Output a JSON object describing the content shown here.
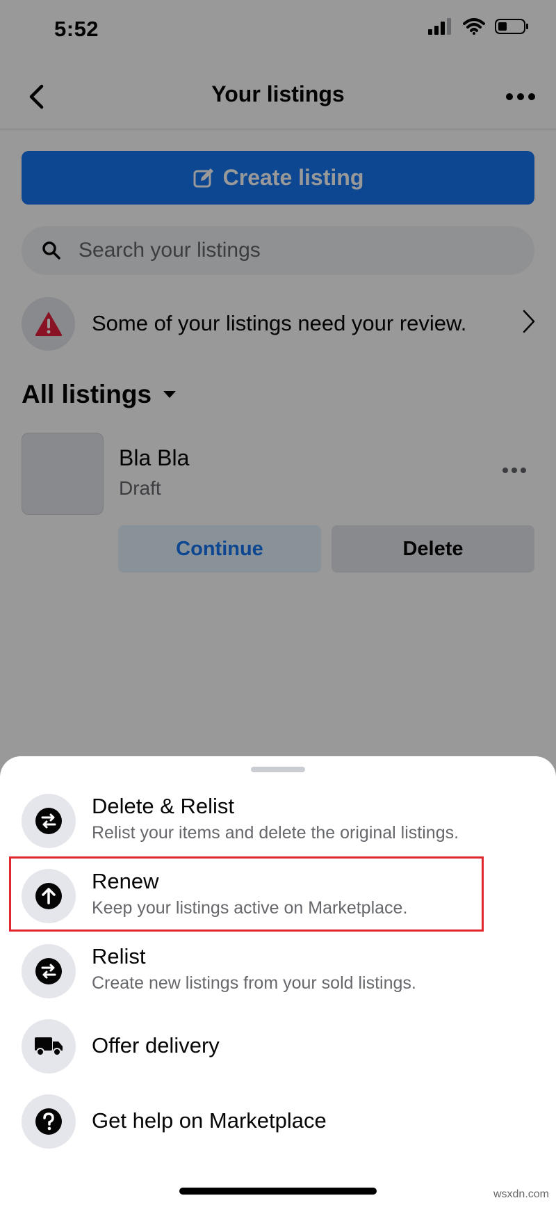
{
  "status_bar": {
    "time": "5:52"
  },
  "nav": {
    "title": "Your listings"
  },
  "create_button": {
    "label": "Create listing",
    "color": "#1877f2"
  },
  "search": {
    "placeholder": "Search your listings",
    "value": ""
  },
  "review_banner": {
    "text": "Some of your listings need your review."
  },
  "listings_filter": {
    "label": "All listings"
  },
  "listing": {
    "title": "Bla Bla",
    "status": "Draft",
    "continue_label": "Continue",
    "delete_label": "Delete"
  },
  "sheet": {
    "options": [
      {
        "title": "Delete & Relist",
        "subtitle": "Relist your items and delete the original listings.",
        "icon": "swap-arrows-icon"
      },
      {
        "title": "Renew",
        "subtitle": "Keep your listings active on Marketplace.",
        "icon": "arrow-up-circle-icon"
      },
      {
        "title": "Relist",
        "subtitle": "Create new listings from your sold listings.",
        "icon": "swap-arrows-icon"
      },
      {
        "title": "Offer delivery",
        "icon": "truck-icon"
      },
      {
        "title": "Get help on Marketplace",
        "icon": "question-circle-icon"
      }
    ],
    "highlight_color": "#e0262e"
  },
  "watermark": "wsxdn.com"
}
